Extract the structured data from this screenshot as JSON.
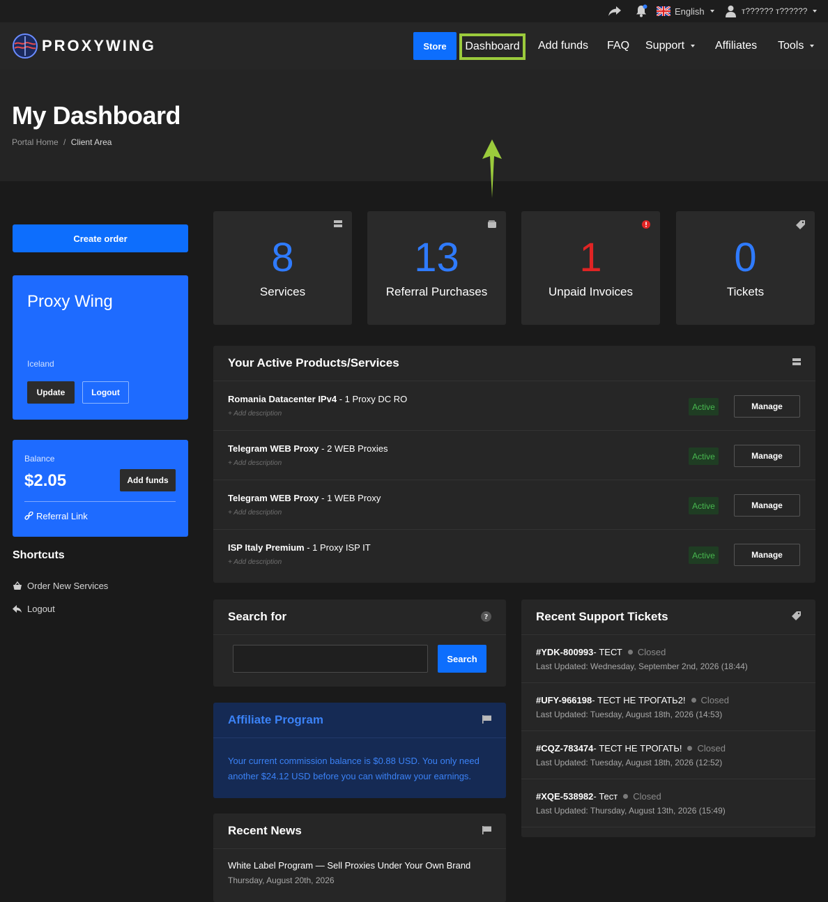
{
  "topbar": {
    "language": "English",
    "user": "т?????? т??????"
  },
  "brand": {
    "logo_text": "PROXYWING"
  },
  "nav": {
    "store": "Store",
    "dashboard": "Dashboard",
    "add_funds": "Add funds",
    "faq": "FAQ",
    "support": "Support",
    "affiliates": "Affiliates",
    "tools": "Tools"
  },
  "header": {
    "title": "My Dashboard",
    "breadcrumb": [
      "Portal Home",
      "/",
      "Client Area"
    ]
  },
  "sidebar": {
    "create_order": "Create order",
    "profile": {
      "name": "Proxy Wing",
      "country": "Iceland",
      "update": "Update",
      "logout": "Logout"
    },
    "balance": {
      "label": "Balance",
      "amount": "$2.05",
      "add_funds": "Add funds",
      "referral": "Referral Link"
    },
    "shortcuts_title": "Shortcuts",
    "shortcuts": [
      "Order New Services",
      "Logout"
    ]
  },
  "stats": [
    {
      "value": "8",
      "label": "Services",
      "color": "#2f7bff",
      "icon": "server-icon"
    },
    {
      "value": "13",
      "label": "Referral Purchases",
      "color": "#2f7bff",
      "icon": "wallet-icon"
    },
    {
      "value": "1",
      "label": "Unpaid Invoices",
      "color": "#e02424",
      "icon": "alert-icon"
    },
    {
      "value": "0",
      "label": "Tickets",
      "color": "#2f7bff",
      "icon": "tag-icon"
    }
  ],
  "products": {
    "title": "Your Active Products/Services",
    "items": [
      {
        "name": "Romania Datacenter IPv4",
        "detail": " - 1 Proxy DC RO",
        "desc": "+ Add description",
        "status": "Active",
        "action": "Manage"
      },
      {
        "name": "Telegram WEB Proxy",
        "detail": " - 2 WEB Proxies",
        "desc": "+ Add description",
        "status": "Active",
        "action": "Manage"
      },
      {
        "name": "Telegram WEB Proxy",
        "detail": " - 1 WEB Proxy",
        "desc": "+ Add description",
        "status": "Active",
        "action": "Manage"
      },
      {
        "name": "ISP Italy Premium",
        "detail": " - 1 Proxy ISP IT",
        "desc": "+ Add description",
        "status": "Active",
        "action": "Manage"
      }
    ]
  },
  "search": {
    "title": "Search for",
    "value": "",
    "button": "Search"
  },
  "affiliate": {
    "title": "Affiliate Program",
    "text": "Your current commission balance is $0.88 USD. You only need another $24.12 USD before you can withdraw your earnings."
  },
  "news": {
    "title": "Recent News",
    "item_title": "White Label Program — Sell Proxies Under Your Own Brand",
    "item_date": "Thursday, August 20th, 2026"
  },
  "tickets": {
    "title": "Recent Support Tickets",
    "items": [
      {
        "id": "#YDK-800993",
        "subject": " - ТЕСТ",
        "status": "Closed",
        "updated": "Last Updated: Wednesday, September 2nd, 2026 (18:44)"
      },
      {
        "id": "#UFY-966198",
        "subject": " - ТЕСТ НЕ ТРОГАТЬ2!",
        "status": "Closed",
        "updated": "Last Updated: Tuesday, August 18th, 2026 (14:53)"
      },
      {
        "id": "#CQZ-783474",
        "subject": " - ТЕСТ НЕ ТРОГАТЬ!",
        "status": "Closed",
        "updated": "Last Updated: Tuesday, August 18th, 2026 (12:52)"
      },
      {
        "id": "#XQE-538982",
        "subject": " - Тест",
        "status": "Closed",
        "updated": "Last Updated: Thursday, August 13th, 2026 (15:49)"
      }
    ]
  },
  "colors": {
    "accent": "#0d6efd",
    "highlight": "#9bcb3c",
    "active_badge": "#48b84f",
    "danger": "#e02424"
  }
}
